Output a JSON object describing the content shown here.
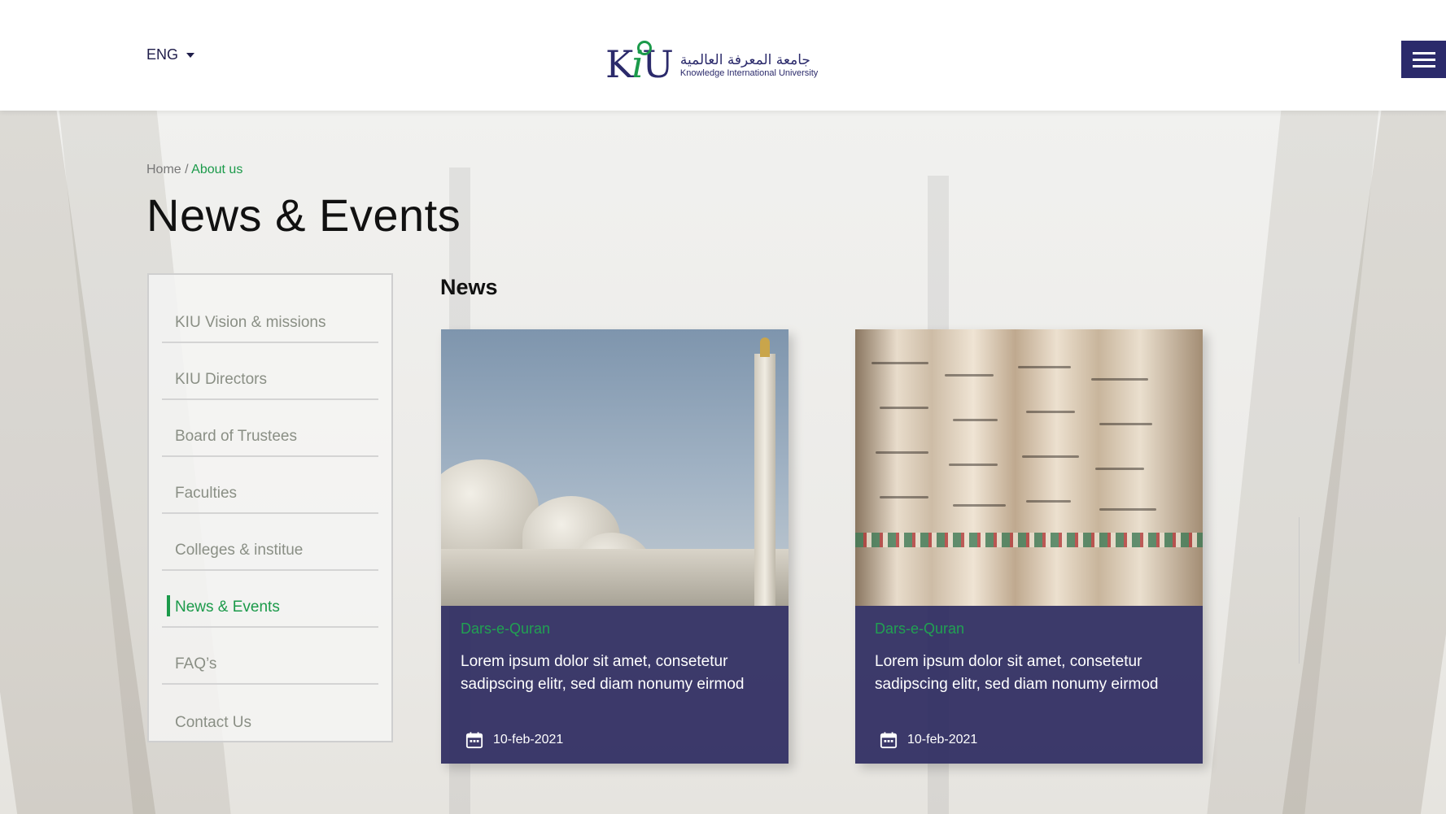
{
  "header": {
    "language": "ENG",
    "logo": {
      "mark": "KIU",
      "arabic_name": "جامعة المعرفة العالمية",
      "english_name": "Knowledge International University"
    },
    "menu_icon": "hamburger-icon"
  },
  "breadcrumb": {
    "home": "Home",
    "separator": "/",
    "current": "About us"
  },
  "page_title": "News & Events",
  "sidebar": {
    "items": [
      {
        "label": "KIU Vision & missions",
        "active": false
      },
      {
        "label": "KIU Directors",
        "active": false
      },
      {
        "label": "Board of Trustees",
        "active": false
      },
      {
        "label": "Faculties",
        "active": false
      },
      {
        "label": "Colleges & institue",
        "active": false
      },
      {
        "label": "News & Events",
        "active": true
      },
      {
        "label": "FAQ’s",
        "active": false
      },
      {
        "label": "Contact Us",
        "active": false
      }
    ]
  },
  "news": {
    "heading": "News",
    "cards": [
      {
        "image": "mosque-photo",
        "category": "Dars-e-Quran",
        "description": "Lorem ipsum dolor sit amet, consetetur sadipscing elitr, sed diam nonumy eirmod",
        "date": "10-feb-2021",
        "date_icon": "calendar-icon"
      },
      {
        "image": "quran-scroll-photo",
        "category": "Dars-e-Quran",
        "description": "Lorem ipsum dolor sit amet, consetetur sadipscing elitr, sed diam nonumy eirmod",
        "date": "10-feb-2021",
        "date_icon": "calendar-icon"
      }
    ]
  },
  "colors": {
    "brand_navy": "#2b2a6b",
    "brand_green": "#1b9a4a",
    "card_overlay": "#2c2a60"
  }
}
